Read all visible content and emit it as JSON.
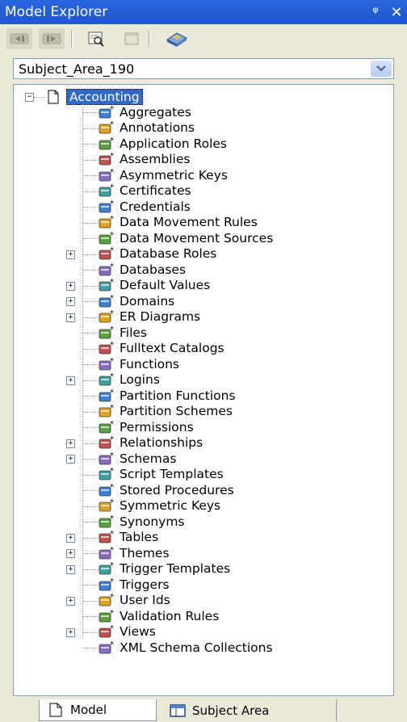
{
  "window": {
    "title": "Model Explorer",
    "pin_glyph": "ᵠ",
    "close_glyph": "✕"
  },
  "toolbar": {
    "buttons": [
      "back-icon",
      "forward-icon",
      "find-icon",
      "properties-icon",
      "eraser-icon"
    ]
  },
  "selector": {
    "value": "Subject_Area_190"
  },
  "tree": {
    "root": "Accounting",
    "items": [
      {
        "label": "Aggregates",
        "icon": "aggregate-icon",
        "expandable": false
      },
      {
        "label": "Annotations",
        "icon": "annotation-icon",
        "expandable": false
      },
      {
        "label": "Application Roles",
        "icon": "application-role-icon",
        "expandable": false
      },
      {
        "label": "Assemblies",
        "icon": "assembly-icon",
        "expandable": false
      },
      {
        "label": "Asymmetric Keys",
        "icon": "key-icon",
        "expandable": false
      },
      {
        "label": "Certificates",
        "icon": "certificate-icon",
        "expandable": false
      },
      {
        "label": "Credentials",
        "icon": "credential-icon",
        "expandable": false
      },
      {
        "label": "Data Movement Rules",
        "icon": "data-movement-rule-icon",
        "expandable": false
      },
      {
        "label": "Data Movement Sources",
        "icon": "data-movement-source-icon",
        "expandable": false
      },
      {
        "label": "Database Roles",
        "icon": "database-role-icon",
        "expandable": true
      },
      {
        "label": "Databases",
        "icon": "database-icon",
        "expandable": false
      },
      {
        "label": "Default Values",
        "icon": "default-value-icon",
        "expandable": true
      },
      {
        "label": "Domains",
        "icon": "domain-icon",
        "expandable": true
      },
      {
        "label": "ER Diagrams",
        "icon": "er-diagram-icon",
        "expandable": true
      },
      {
        "label": "Files",
        "icon": "file-icon",
        "expandable": false
      },
      {
        "label": "Fulltext Catalogs",
        "icon": "fulltext-catalog-icon",
        "expandable": false
      },
      {
        "label": "Functions",
        "icon": "function-icon",
        "expandable": false
      },
      {
        "label": "Logins",
        "icon": "login-icon",
        "expandable": true
      },
      {
        "label": "Partition Functions",
        "icon": "partition-function-icon",
        "expandable": false
      },
      {
        "label": "Partition Schemes",
        "icon": "partition-scheme-icon",
        "expandable": false
      },
      {
        "label": "Permissions",
        "icon": "permission-icon",
        "expandable": false
      },
      {
        "label": "Relationships",
        "icon": "relationship-icon",
        "expandable": true
      },
      {
        "label": "Schemas",
        "icon": "schema-icon",
        "expandable": true
      },
      {
        "label": "Script Templates",
        "icon": "script-template-icon",
        "expandable": false
      },
      {
        "label": "Stored Procedures",
        "icon": "stored-procedure-icon",
        "expandable": false
      },
      {
        "label": "Symmetric Keys",
        "icon": "symmetric-key-icon",
        "expandable": false
      },
      {
        "label": "Synonyms",
        "icon": "synonym-icon",
        "expandable": false
      },
      {
        "label": "Tables",
        "icon": "table-icon",
        "expandable": true
      },
      {
        "label": "Themes",
        "icon": "theme-icon",
        "expandable": true
      },
      {
        "label": "Trigger Templates",
        "icon": "trigger-template-icon",
        "expandable": true
      },
      {
        "label": "Triggers",
        "icon": "trigger-icon",
        "expandable": false
      },
      {
        "label": "User Ids",
        "icon": "user-id-icon",
        "expandable": true
      },
      {
        "label": "Validation Rules",
        "icon": "validation-rule-icon",
        "expandable": false
      },
      {
        "label": "Views",
        "icon": "view-icon",
        "expandable": true
      },
      {
        "label": "XML Schema Collections",
        "icon": "xml-schema-collection-icon",
        "expandable": false
      }
    ]
  },
  "tabs": [
    {
      "label": "Model",
      "icon": "model-icon",
      "active": true
    },
    {
      "label": "Subject Area",
      "icon": "subject-area-icon",
      "active": false
    }
  ],
  "colors": {
    "titlebar": "#2a66e0",
    "selection": "#316ac5",
    "panel": "#ece9d8"
  }
}
